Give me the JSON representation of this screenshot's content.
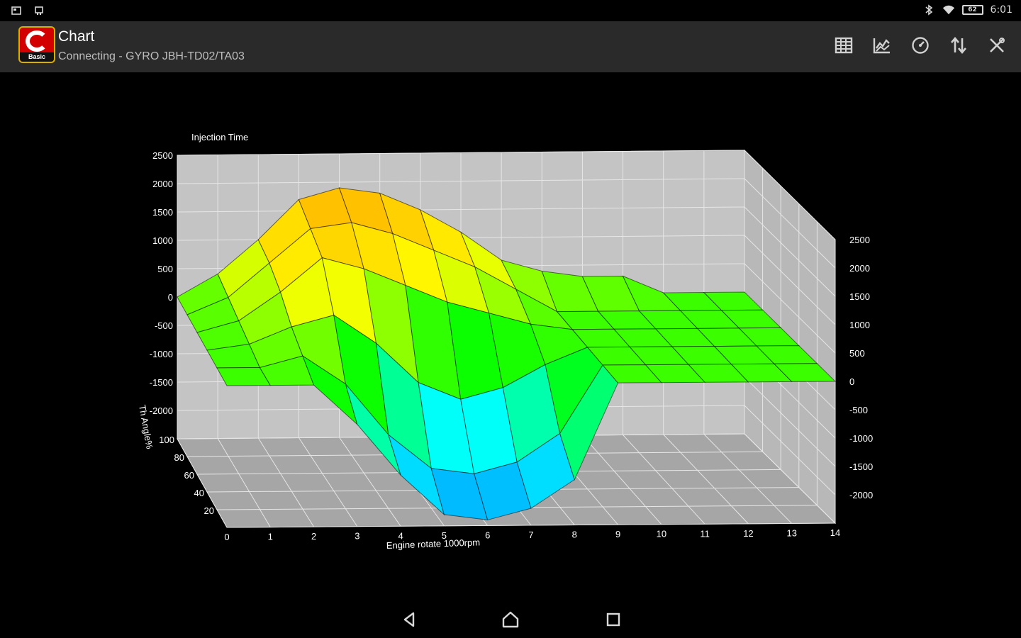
{
  "status_bar": {
    "left_icons": [
      "sd-card-icon",
      "notification-icon"
    ],
    "right_icons": [
      "bluetooth-icon",
      "wifi-icon"
    ],
    "battery": "62",
    "time": "6:01"
  },
  "app_bar": {
    "logo_text": "Basic",
    "title": "Chart",
    "subtitle": "Connecting - GYRO JBH-TD02/TA03",
    "actions": [
      {
        "name": "table-view-button",
        "icon": "grid-icon"
      },
      {
        "name": "chart-view-button",
        "icon": "chart-icon"
      },
      {
        "name": "gauge-view-button",
        "icon": "gauge-icon"
      },
      {
        "name": "sort-button",
        "icon": "swap-vertical-icon"
      },
      {
        "name": "tools-button",
        "icon": "tools-icon"
      }
    ]
  },
  "chart_data": {
    "type": "surface3d",
    "title": "Injection Time",
    "xlabel": "Engine rotate 1000rpm",
    "ylabel": "Th Angle%",
    "zlabel": "Injection Time",
    "x_ticks": [
      "0",
      "1",
      "2",
      "3",
      "4",
      "5",
      "6",
      "7",
      "8",
      "9",
      "10",
      "11",
      "12",
      "13",
      "14"
    ],
    "y_ticks": [
      "20",
      "40",
      "60",
      "80",
      "100"
    ],
    "z_ticks_left": [
      "2500",
      "2000",
      "1500",
      "1000",
      "500",
      "0",
      "-500",
      "-1000",
      "-1500",
      "-2000"
    ],
    "z_ticks_right": [
      "2500",
      "2000",
      "1500",
      "1000",
      "500",
      "0",
      "-500",
      "-1000",
      "-1500",
      "-2000"
    ],
    "xlim": [
      0,
      14
    ],
    "ylim": [
      0,
      100
    ],
    "zlim": [
      -2500,
      2500
    ],
    "x": [
      0,
      1,
      2,
      3,
      4,
      5,
      6,
      7,
      8,
      9,
      10,
      11,
      12,
      13,
      14
    ],
    "y": [
      0,
      20,
      40,
      60,
      80,
      100
    ],
    "z": [
      [
        0,
        0,
        0,
        -700,
        -1600,
        -2300,
        -2400,
        -2200,
        -1700,
        0,
        0,
        0,
        0,
        0,
        0
      ],
      [
        0,
        0,
        200,
        -300,
        -1200,
        -1800,
        -1900,
        -1700,
        -1200,
        0,
        0,
        0,
        0,
        0,
        0
      ],
      [
        0,
        100,
        400,
        600,
        100,
        -600,
        -900,
        -700,
        -300,
        0,
        0,
        0,
        0,
        0,
        0
      ],
      [
        0,
        200,
        700,
        1300,
        1100,
        800,
        500,
        300,
        100,
        0,
        0,
        0,
        0,
        0,
        0
      ],
      [
        0,
        300,
        900,
        1500,
        1600,
        1400,
        1100,
        800,
        400,
        0,
        0,
        0,
        0,
        0,
        0
      ],
      [
        0,
        400,
        1000,
        1700,
        1900,
        1800,
        1500,
        1100,
        600,
        400,
        300,
        300,
        0,
        0,
        0
      ]
    ],
    "colormap": [
      "#00a0ff",
      "#00ffff",
      "#00ff00",
      "#ffff00",
      "#ffb000"
    ],
    "grid": true
  },
  "nav_bar": {
    "back": "back-icon",
    "home": "home-icon",
    "recents": "recents-icon"
  }
}
